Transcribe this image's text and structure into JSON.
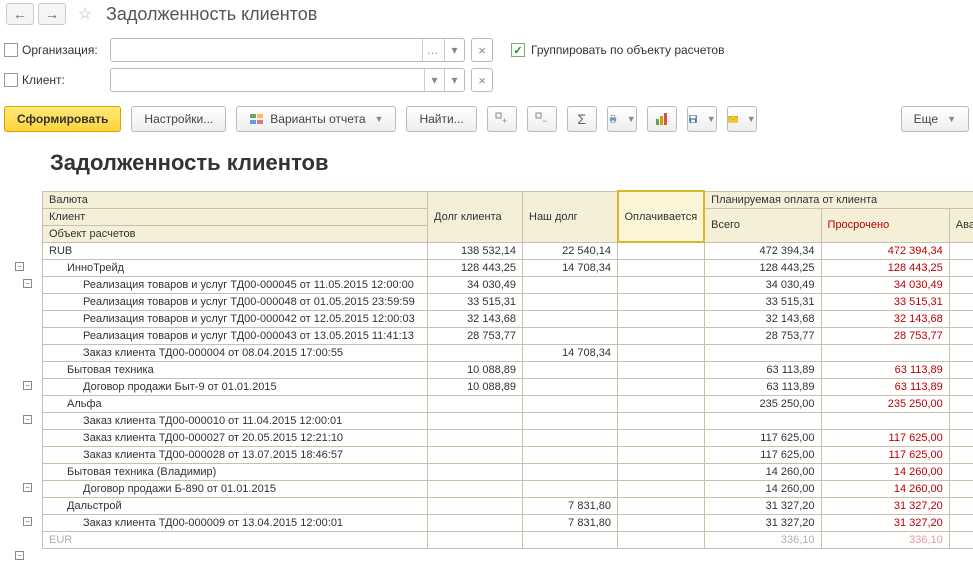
{
  "title": "Задолженность клиентов",
  "filters": {
    "org_label": "Организация:",
    "client_label": "Клиент:",
    "group_label": "Группировать по объекту расчетов"
  },
  "toolbar": {
    "form": "Сформировать",
    "settings": "Настройки...",
    "variants": "Варианты отчета",
    "find": "Найти...",
    "more": "Еще"
  },
  "report": {
    "title": "Задолженность клиентов",
    "headers": {
      "currency": "Валюта",
      "client": "Клиент",
      "object": "Объект расчетов",
      "debt": "Долг клиента",
      "our_debt": "Наш долг",
      "paying": "Оплачивается",
      "planned": "Планируемая оплата от клиента",
      "total": "Всего",
      "overdue": "Просрочено",
      "advance": "Аванс обеспе"
    },
    "rows": [
      {
        "lvl": 1,
        "name": "RUB",
        "c1": "138 532,14",
        "c2": "22 540,14",
        "c4": "472 394,34",
        "c5": "472 394,34"
      },
      {
        "lvl": 2,
        "name": "ИнноТрейд",
        "c1": "128 443,25",
        "c2": "14 708,34",
        "c4": "128 443,25",
        "c5": "128 443,25"
      },
      {
        "lvl": 3,
        "name": "Реализация товаров и услуг ТД00-000045 от 11.05.2015 12:00:00",
        "c1": "34 030,49",
        "c4": "34 030,49",
        "c5": "34 030,49"
      },
      {
        "lvl": 3,
        "name": "Реализация товаров и услуг ТД00-000048 от 01.05.2015 23:59:59",
        "c1": "33 515,31",
        "c4": "33 515,31",
        "c5": "33 515,31"
      },
      {
        "lvl": 3,
        "name": "Реализация товаров и услуг ТД00-000042 от 12.05.2015 12:00:03",
        "c1": "32 143,68",
        "c4": "32 143,68",
        "c5": "32 143,68"
      },
      {
        "lvl": 3,
        "name": "Реализация товаров и услуг ТД00-000043 от 13.05.2015 11:41:13",
        "c1": "28 753,77",
        "c4": "28 753,77",
        "c5": "28 753,77"
      },
      {
        "lvl": 3,
        "name": "Заказ клиента ТД00-000004 от 08.04.2015 17:00:55",
        "c2": "14 708,34"
      },
      {
        "lvl": 2,
        "name": "Бытовая техника",
        "c1": "10 088,89",
        "c4": "63 113,89",
        "c5": "63 113,89"
      },
      {
        "lvl": 3,
        "name": "Договор продажи Быт-9 от 01.01.2015",
        "c1": "10 088,89",
        "c4": "63 113,89",
        "c5": "63 113,89"
      },
      {
        "lvl": 2,
        "name": "Альфа",
        "c4": "235 250,00",
        "c5": "235 250,00"
      },
      {
        "lvl": 3,
        "name": "Заказ клиента ТД00-000010 от 11.04.2015 12:00:01"
      },
      {
        "lvl": 3,
        "name": "Заказ клиента ТД00-000027 от 20.05.2015 12:21:10",
        "c4": "117 625,00",
        "c5": "117 625,00"
      },
      {
        "lvl": 3,
        "name": "Заказ клиента ТД00-000028 от 13.07.2015 18:46:57",
        "c4": "117 625,00",
        "c5": "117 625,00"
      },
      {
        "lvl": 2,
        "name": "Бытовая техника (Владимир)",
        "c4": "14 260,00",
        "c5": "14 260,00"
      },
      {
        "lvl": 3,
        "name": "Договор продажи Б-890 от 01.01.2015",
        "c4": "14 260,00",
        "c5": "14 260,00"
      },
      {
        "lvl": 2,
        "name": "Дальстрой",
        "c2": "7 831,80",
        "c4": "31 327,20",
        "c5": "31 327,20"
      },
      {
        "lvl": 3,
        "name": "Заказ клиента ТД00-000009 от 13.04.2015 12:00:01",
        "c2": "7 831,80",
        "c4": "31 327,20",
        "c5": "31 327,20"
      },
      {
        "lvl": 1,
        "name": "EUR",
        "c4": "336,10",
        "c5": "336,10",
        "dim": true
      }
    ]
  },
  "chart_data": {
    "type": "table",
    "title": "Задолженность клиентов",
    "columns": [
      "Валюта/Клиент/Объект расчетов",
      "Долг клиента",
      "Наш долг",
      "Оплачивается",
      "Всего",
      "Просрочено"
    ],
    "rows": [
      [
        "RUB",
        138532.14,
        22540.14,
        null,
        472394.34,
        472394.34
      ],
      [
        "ИнноТрейд",
        128443.25,
        14708.34,
        null,
        128443.25,
        128443.25
      ],
      [
        "Реализация ТД00-000045 11.05.2015",
        34030.49,
        null,
        null,
        34030.49,
        34030.49
      ],
      [
        "Реализация ТД00-000048 01.05.2015",
        33515.31,
        null,
        null,
        33515.31,
        33515.31
      ],
      [
        "Реализация ТД00-000042 12.05.2015",
        32143.68,
        null,
        null,
        32143.68,
        32143.68
      ],
      [
        "Реализация ТД00-000043 13.05.2015",
        28753.77,
        null,
        null,
        28753.77,
        28753.77
      ],
      [
        "Заказ ТД00-000004 08.04.2015",
        null,
        14708.34,
        null,
        null,
        null
      ],
      [
        "Бытовая техника",
        10088.89,
        null,
        null,
        63113.89,
        63113.89
      ],
      [
        "Договор Быт-9 01.01.2015",
        10088.89,
        null,
        null,
        63113.89,
        63113.89
      ],
      [
        "Альфа",
        null,
        null,
        null,
        235250.0,
        235250.0
      ],
      [
        "Заказ ТД00-000010 11.04.2015",
        null,
        null,
        null,
        null,
        null
      ],
      [
        "Заказ ТД00-000027 20.05.2015",
        null,
        null,
        null,
        117625.0,
        117625.0
      ],
      [
        "Заказ ТД00-000028 13.07.2015",
        null,
        null,
        null,
        117625.0,
        117625.0
      ],
      [
        "Бытовая техника (Владимир)",
        null,
        null,
        null,
        14260.0,
        14260.0
      ],
      [
        "Договор Б-890 01.01.2015",
        null,
        null,
        null,
        14260.0,
        14260.0
      ],
      [
        "Дальстрой",
        null,
        7831.8,
        null,
        31327.2,
        31327.2
      ],
      [
        "Заказ ТД00-000009 13.04.2015",
        null,
        7831.8,
        null,
        31327.2,
        31327.2
      ],
      [
        "EUR",
        null,
        null,
        null,
        336.1,
        336.1
      ]
    ]
  }
}
